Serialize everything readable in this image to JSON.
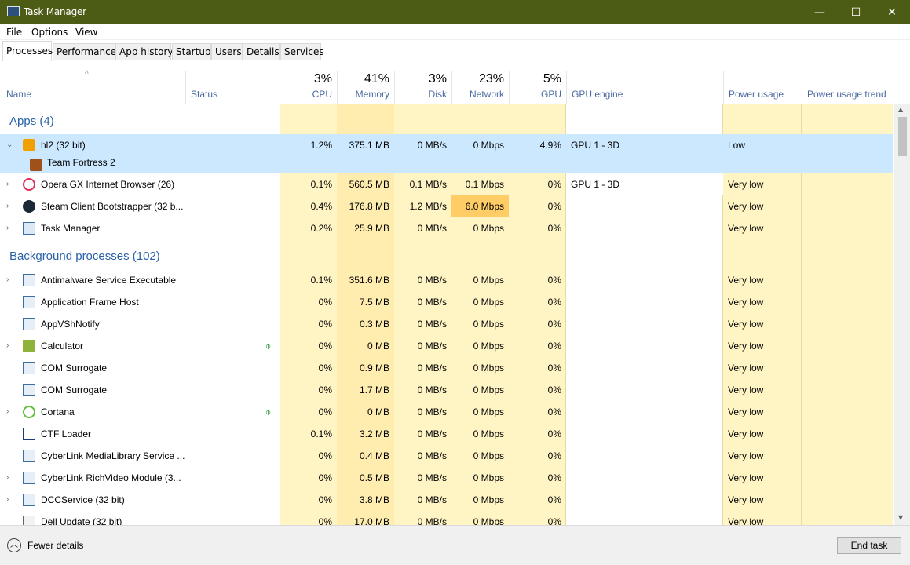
{
  "window": {
    "title": "Task Manager",
    "minimize": "—",
    "maximize": "☐",
    "close": "✕"
  },
  "menu": [
    "File",
    "Options",
    "View"
  ],
  "tabs": [
    "Processes",
    "Performance",
    "App history",
    "Startup",
    "Users",
    "Details",
    "Services"
  ],
  "header": {
    "name": "Name",
    "status": "Status",
    "cpu_pct": "3%",
    "cpu": "CPU",
    "memory_pct": "41%",
    "memory": "Memory",
    "disk_pct": "3%",
    "disk": "Disk",
    "network_pct": "23%",
    "network": "Network",
    "gpu_pct": "5%",
    "gpu": "GPU",
    "gpu_engine": "GPU engine",
    "power": "Power usage",
    "power_trend": "Power usage trend"
  },
  "groups": {
    "apps": "Apps (4)",
    "background": "Background processes (102)"
  },
  "rows": [
    {
      "name": "hl2 (32 bit)",
      "cpu": "1.2%",
      "mem": "375.1 MB",
      "disk": "0 MB/s",
      "net": "0 Mbps",
      "gpu": "4.9%",
      "engine": "GPU 1 - 3D",
      "power": "Low"
    },
    {
      "name": "Team Fortress 2"
    },
    {
      "name": "Opera GX Internet Browser (26)",
      "cpu": "0.1%",
      "mem": "560.5 MB",
      "disk": "0.1 MB/s",
      "net": "0.1 Mbps",
      "gpu": "0%",
      "engine": "GPU 1 - 3D",
      "power": "Very low"
    },
    {
      "name": "Steam Client Bootstrapper (32 b...",
      "cpu": "0.4%",
      "mem": "176.8 MB",
      "disk": "1.2 MB/s",
      "net": "6.0 Mbps",
      "gpu": "0%",
      "engine": "",
      "power": "Very low"
    },
    {
      "name": "Task Manager",
      "cpu": "0.2%",
      "mem": "25.9 MB",
      "disk": "0 MB/s",
      "net": "0 Mbps",
      "gpu": "0%",
      "engine": "",
      "power": "Very low"
    },
    {
      "name": "Antimalware Service Executable",
      "cpu": "0.1%",
      "mem": "351.6 MB",
      "disk": "0 MB/s",
      "net": "0 Mbps",
      "gpu": "0%",
      "engine": "",
      "power": "Very low"
    },
    {
      "name": "Application Frame Host",
      "cpu": "0%",
      "mem": "7.5 MB",
      "disk": "0 MB/s",
      "net": "0 Mbps",
      "gpu": "0%",
      "engine": "",
      "power": "Very low"
    },
    {
      "name": "AppVShNotify",
      "cpu": "0%",
      "mem": "0.3 MB",
      "disk": "0 MB/s",
      "net": "0 Mbps",
      "gpu": "0%",
      "engine": "",
      "power": "Very low"
    },
    {
      "name": "Calculator",
      "cpu": "0%",
      "mem": "0 MB",
      "disk": "0 MB/s",
      "net": "0 Mbps",
      "gpu": "0%",
      "engine": "",
      "power": "Very low"
    },
    {
      "name": "COM Surrogate",
      "cpu": "0%",
      "mem": "0.9 MB",
      "disk": "0 MB/s",
      "net": "0 Mbps",
      "gpu": "0%",
      "engine": "",
      "power": "Very low"
    },
    {
      "name": "COM Surrogate",
      "cpu": "0%",
      "mem": "1.7 MB",
      "disk": "0 MB/s",
      "net": "0 Mbps",
      "gpu": "0%",
      "engine": "",
      "power": "Very low"
    },
    {
      "name": "Cortana",
      "cpu": "0%",
      "mem": "0 MB",
      "disk": "0 MB/s",
      "net": "0 Mbps",
      "gpu": "0%",
      "engine": "",
      "power": "Very low"
    },
    {
      "name": "CTF Loader",
      "cpu": "0.1%",
      "mem": "3.2 MB",
      "disk": "0 MB/s",
      "net": "0 Mbps",
      "gpu": "0%",
      "engine": "",
      "power": "Very low"
    },
    {
      "name": "CyberLink MediaLibrary Service ...",
      "cpu": "0%",
      "mem": "0.4 MB",
      "disk": "0 MB/s",
      "net": "0 Mbps",
      "gpu": "0%",
      "engine": "",
      "power": "Very low"
    },
    {
      "name": "CyberLink RichVideo Module (3...",
      "cpu": "0%",
      "mem": "0.5 MB",
      "disk": "0 MB/s",
      "net": "0 Mbps",
      "gpu": "0%",
      "engine": "",
      "power": "Very low"
    },
    {
      "name": "DCCService (32 bit)",
      "cpu": "0%",
      "mem": "3.8 MB",
      "disk": "0 MB/s",
      "net": "0 Mbps",
      "gpu": "0%",
      "engine": "",
      "power": "Very low"
    },
    {
      "name": "Dell Update (32 bit)",
      "cpu": "0%",
      "mem": "17.0 MB",
      "disk": "0 MB/s",
      "net": "0 Mbps",
      "gpu": "0%",
      "engine": "",
      "power": "Very low"
    }
  ],
  "footer": {
    "fewer_details": "Fewer details",
    "end_task": "End task"
  },
  "colors": {
    "titlebar": "#4c5c14",
    "heat_light": "#fff4c4",
    "heat_med": "#ffe9a8",
    "heat_high": "#ffcc66",
    "selected": "#cce8ff",
    "group_text": "#2a61a8"
  }
}
